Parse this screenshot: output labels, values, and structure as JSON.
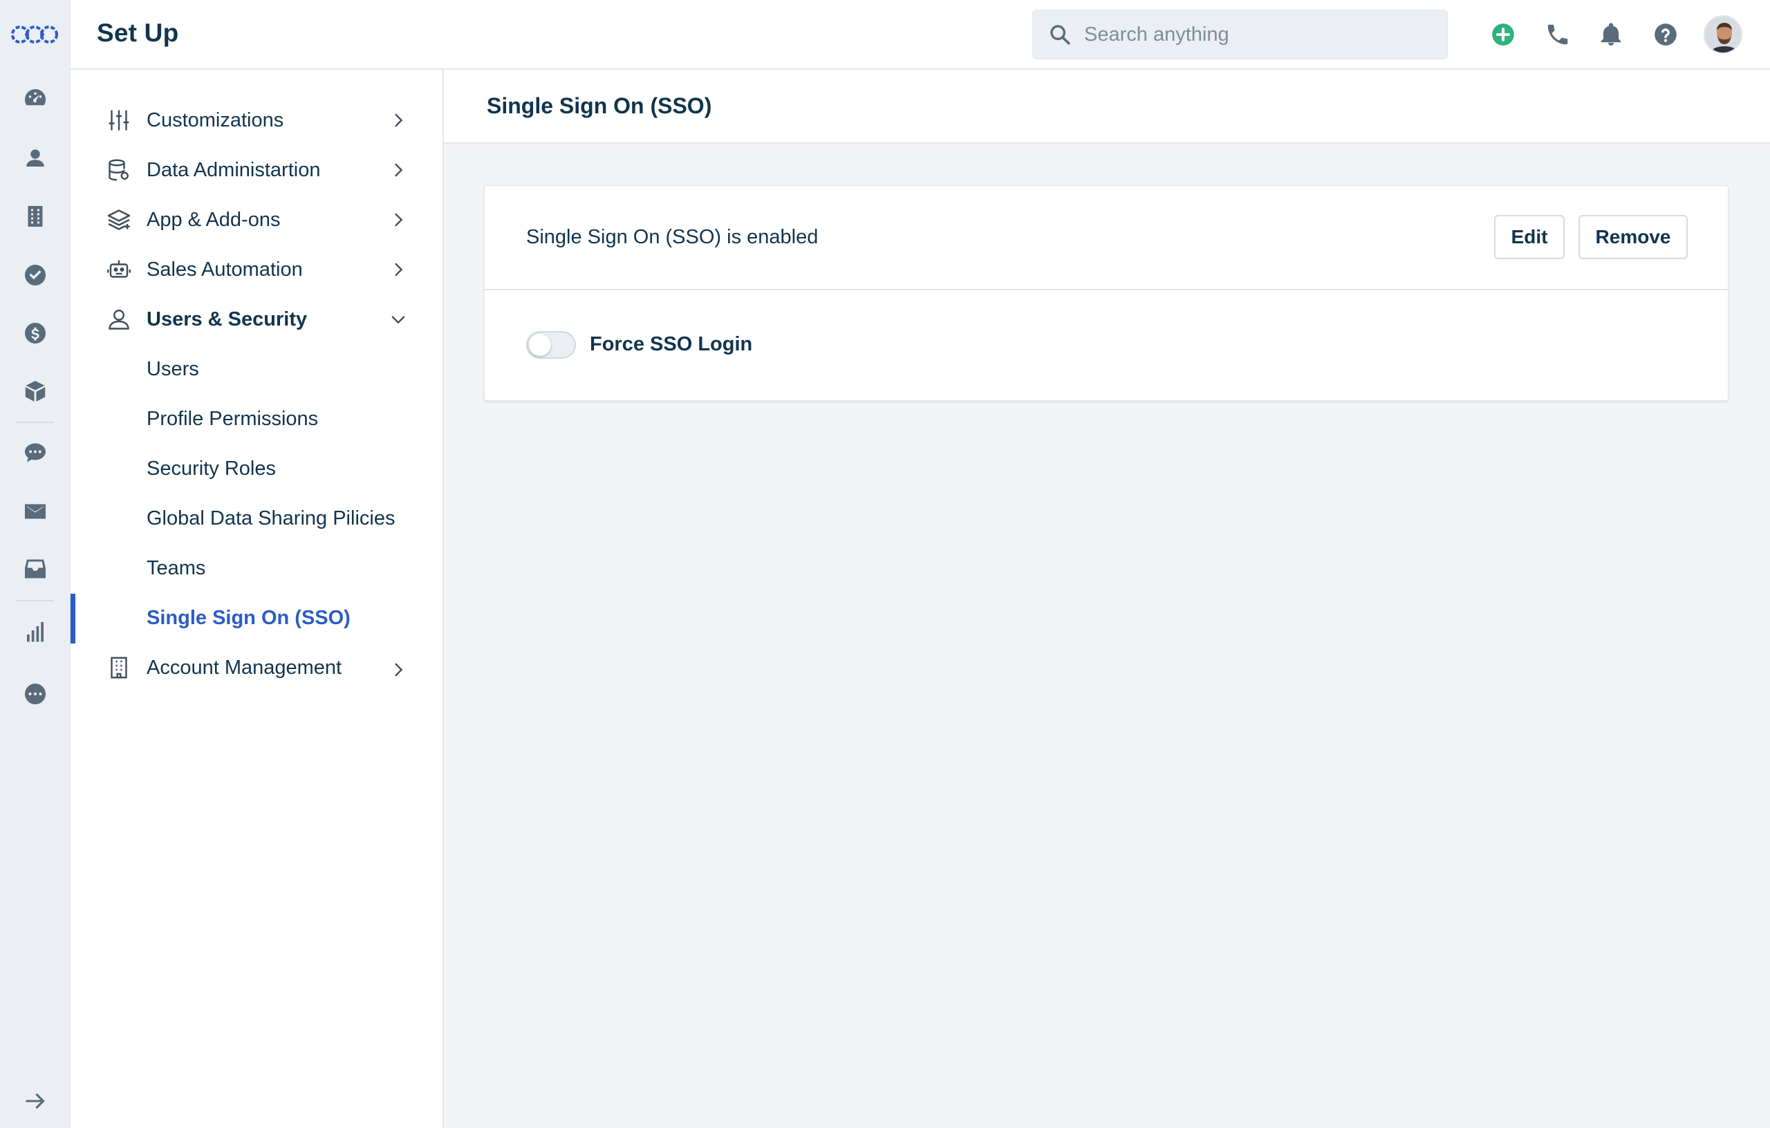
{
  "header": {
    "title": "Set Up",
    "search_placeholder": "Search anything"
  },
  "rail": {
    "icons": [
      "dashboard-icon",
      "contacts-icon",
      "accounts-icon",
      "tasks-icon",
      "deals-icon",
      "products-icon",
      "chat-icon",
      "mail-icon",
      "inbox-icon",
      "reports-icon",
      "more-icon",
      "expand-arrow-icon"
    ]
  },
  "sidenav": {
    "items": [
      {
        "label": "Customizations",
        "icon": "sliders-icon"
      },
      {
        "label": "Data Administartion",
        "icon": "database-icon"
      },
      {
        "label": "App & Add-ons",
        "icon": "layers-icon"
      },
      {
        "label": "Sales Automation",
        "icon": "robot-icon"
      },
      {
        "label": "Users & Security",
        "icon": "user-icon"
      },
      {
        "label": "Account Management",
        "icon": "building-icon"
      }
    ],
    "subitems": [
      {
        "label": "Users"
      },
      {
        "label": "Profile Permissions"
      },
      {
        "label": "Security Roles"
      },
      {
        "label": "Global Data Sharing Pilicies"
      },
      {
        "label": "Teams"
      },
      {
        "label": "Single Sign On (SSO)"
      }
    ]
  },
  "content": {
    "title": "Single Sign On (SSO)",
    "status_text": "Single Sign On (SSO) is enabled",
    "edit_label": "Edit",
    "remove_label": "Remove",
    "force_sso_label": "Force SSO Login",
    "force_sso_enabled": false
  },
  "colors": {
    "accent": "#2c5cc5",
    "add": "#2db37d",
    "text": "#12344d",
    "muted_icon": "#5a6b7b"
  }
}
